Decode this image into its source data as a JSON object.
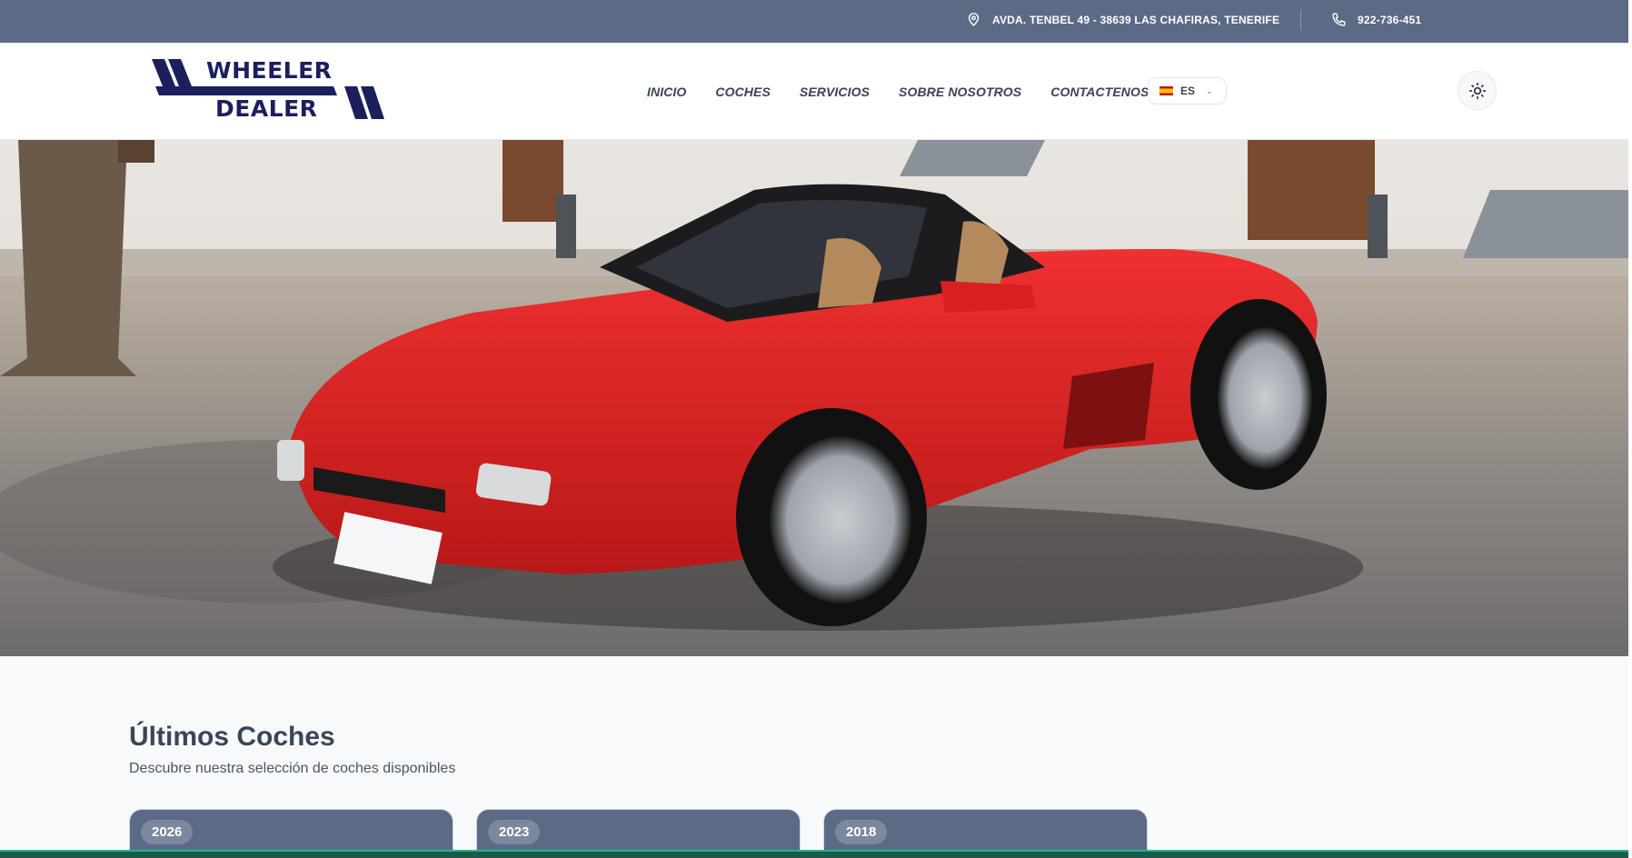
{
  "topbar": {
    "address": "AVDA. TENBEL 49 - 38639 LAS CHAFIRAS, TENERIFE",
    "phone": "922-736-451"
  },
  "brand": {
    "line1": "WHEELER",
    "line2": "DEALER",
    "color": "#1b1f5c"
  },
  "nav": {
    "items": [
      {
        "label": "INICIO"
      },
      {
        "label": "COCHES"
      },
      {
        "label": "SERVICIOS"
      },
      {
        "label": "SOBRE NOSOTROS"
      },
      {
        "label": "CONTACTENOS"
      }
    ]
  },
  "language": {
    "selected": "ES"
  },
  "colors": {
    "topbar": "#5b6a85",
    "car_red": "#d81f1f"
  },
  "latest": {
    "title": "Últimos Coches",
    "subtitle": "Descubre nuestra selección de coches disponibles",
    "cards": [
      {
        "year": "2026"
      },
      {
        "year": "2023"
      },
      {
        "year": "2018"
      }
    ]
  }
}
